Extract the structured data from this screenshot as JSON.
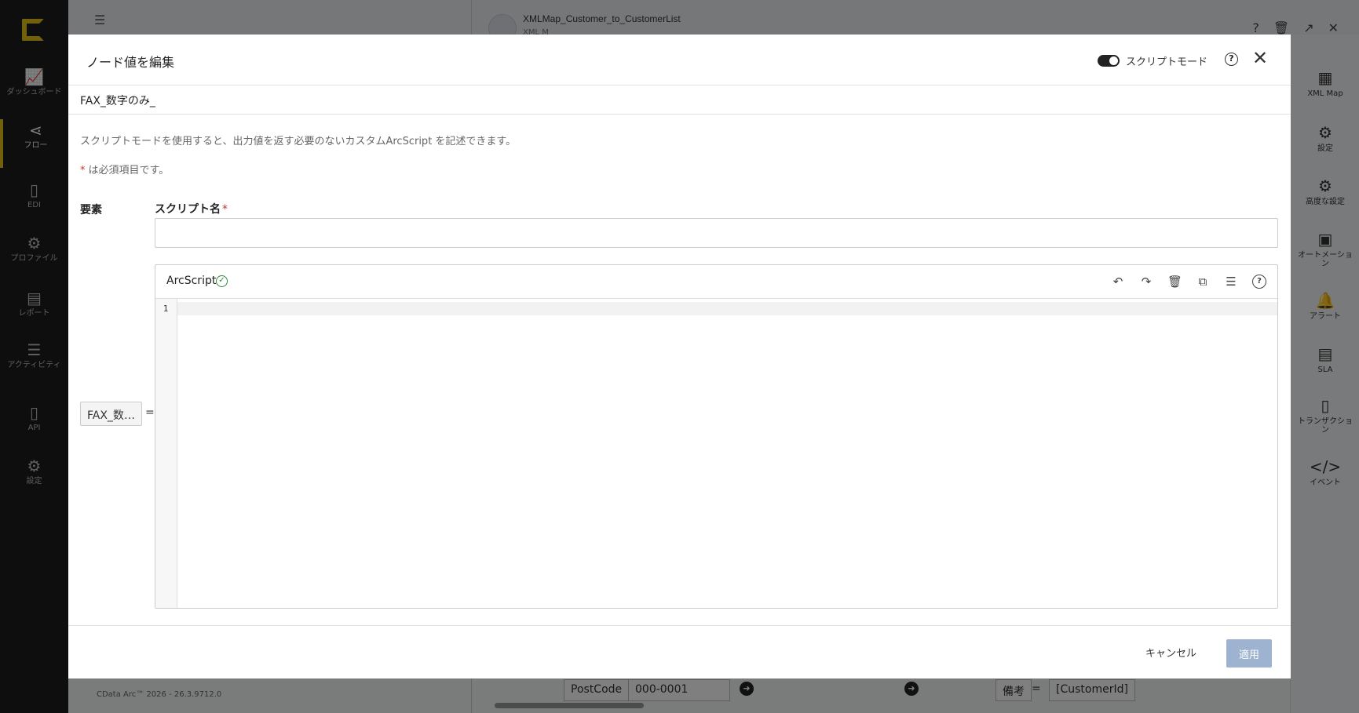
{
  "leftnav": {
    "items": [
      {
        "label": "ダッシュボード",
        "icon": "chart-line-icon"
      },
      {
        "label": "フロー",
        "icon": "share-nodes-icon",
        "active": true
      },
      {
        "label": "EDI",
        "icon": "documents-icon"
      },
      {
        "label": "プロファイル",
        "icon": "gears-icon"
      },
      {
        "label": "レポート",
        "icon": "report-icon"
      },
      {
        "label": "アクティビティ",
        "icon": "layers-icon"
      },
      {
        "label": "API",
        "icon": "api-file-icon"
      },
      {
        "label": "設定",
        "icon": "gear-icon"
      }
    ]
  },
  "background": {
    "menu_glyph": "☰",
    "flow_title": "XMLMap_Customer_to_CustomerList",
    "flow_subtitle": "XML M",
    "version": "CData Arc™ 2026 - 26.3.9712.0",
    "rows": {
      "postcode_label": "PostCode",
      "postcode_value": "000-0001",
      "bikou_label": "備考",
      "eq": "=",
      "customer_id": "[CustomerId]"
    }
  },
  "rightbar": {
    "items": [
      {
        "label": "XML Map",
        "icon": "grid-icon"
      },
      {
        "label": "設定",
        "icon": "gear-icon"
      },
      {
        "label": "高度な設定",
        "icon": "gears-icon"
      },
      {
        "label": "オートメーション",
        "icon": "folder-gear-icon"
      },
      {
        "label": "アラート",
        "icon": "bell-icon"
      },
      {
        "label": "SLA",
        "icon": "sla-file-icon"
      },
      {
        "label": "トランザクション",
        "icon": "file-icon"
      },
      {
        "label": "イベント",
        "icon": "code-icon"
      }
    ]
  },
  "modal": {
    "title": "ノード値を編集",
    "script_mode_label": "スクリプトモード",
    "node_path": "FAX_数字のみ_",
    "description": "スクリプトモードを使用すると、出力値を返す必要のないカスタムArcScript を記述できます。",
    "required_star": "*",
    "required_note": "は必須項目です。",
    "element_label": "要素",
    "script_name_label": "スクリプト名",
    "script_name_value": "",
    "element_value": "FAX_数字のみ_",
    "equals": "=",
    "editor": {
      "title": "ArcScript",
      "line_numbers": [
        "1"
      ]
    },
    "cancel_label": "キャンセル",
    "apply_label": "適用"
  }
}
